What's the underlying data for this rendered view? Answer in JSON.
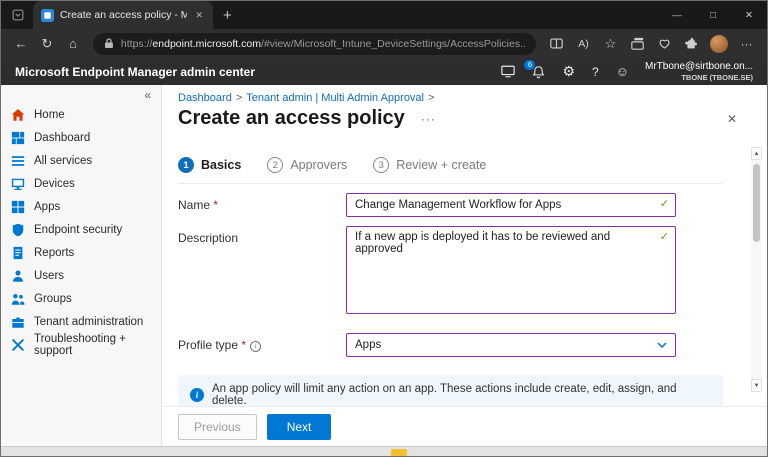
{
  "colors": {
    "accent": "#0078d4",
    "dirty_field_border": "#8a2da5",
    "valid_check_green": "#57a300",
    "link_blue": "#0f6cbd",
    "banner_background": "#eff6fc"
  },
  "browser": {
    "tab": {
      "title": "Create an access policy - Micros...",
      "close_glyph": "✕"
    },
    "new_tab_glyph": "+",
    "nav": {
      "back": "←",
      "refresh": "↻",
      "home": "⌂"
    },
    "url": {
      "prefix": "https://",
      "domain": "endpoint.microsoft.com",
      "path": "/#view/Microsoft_Intune_DeviceSettings/AccessPolicies..."
    },
    "toolbar_icons": {
      "read_aloud": "A)",
      "favorites": "☆",
      "more": "···"
    },
    "window": {
      "minimize": "—",
      "maximize": "□",
      "close": "✕"
    }
  },
  "header": {
    "title": "Microsoft Endpoint Manager admin center",
    "notification_badge": "6",
    "gear_glyph": "⚙",
    "help_glyph": "?",
    "feedback_glyph": "☺",
    "account": {
      "line1": "MrTbone@sirtbone.on...",
      "line2": "TBONE (TBONE.SE)"
    }
  },
  "sidebar": {
    "collapse_glyph": "«",
    "items": [
      {
        "label": "Home"
      },
      {
        "label": "Dashboard"
      },
      {
        "label": "All services"
      },
      {
        "label": "Devices"
      },
      {
        "label": "Apps"
      },
      {
        "label": "Endpoint security"
      },
      {
        "label": "Reports"
      },
      {
        "label": "Users"
      },
      {
        "label": "Groups"
      },
      {
        "label": "Tenant administration"
      },
      {
        "label": "Troubleshooting + support"
      }
    ]
  },
  "main": {
    "breadcrumb": {
      "items": [
        "Dashboard",
        "Tenant admin | Multi Admin Approval"
      ],
      "separator": ">"
    },
    "title": "Create an access policy",
    "more_glyph": "···",
    "close_glyph": "✕",
    "steps": [
      {
        "num": "1",
        "label": "Basics"
      },
      {
        "num": "2",
        "label": "Approvers"
      },
      {
        "num": "3",
        "label": "Review + create"
      }
    ],
    "form": {
      "name_label": "Name",
      "required_mark": "*",
      "name_value": "Change Management Workflow for Apps",
      "description_label": "Description",
      "description_value": "If a new app is deployed it has to be reviewed and approved",
      "profile_type_label": "Profile type",
      "info_glyph": "i",
      "profile_type_value": "Apps",
      "valid_mark": "✓"
    },
    "banner": {
      "icon_glyph": "i",
      "text": "An app policy will limit any action on an app. These actions include create, edit, assign, and delete."
    },
    "footer": {
      "previous": "Previous",
      "next": "Next"
    },
    "scrollbar": {
      "up": "▲",
      "down": "▼"
    }
  }
}
